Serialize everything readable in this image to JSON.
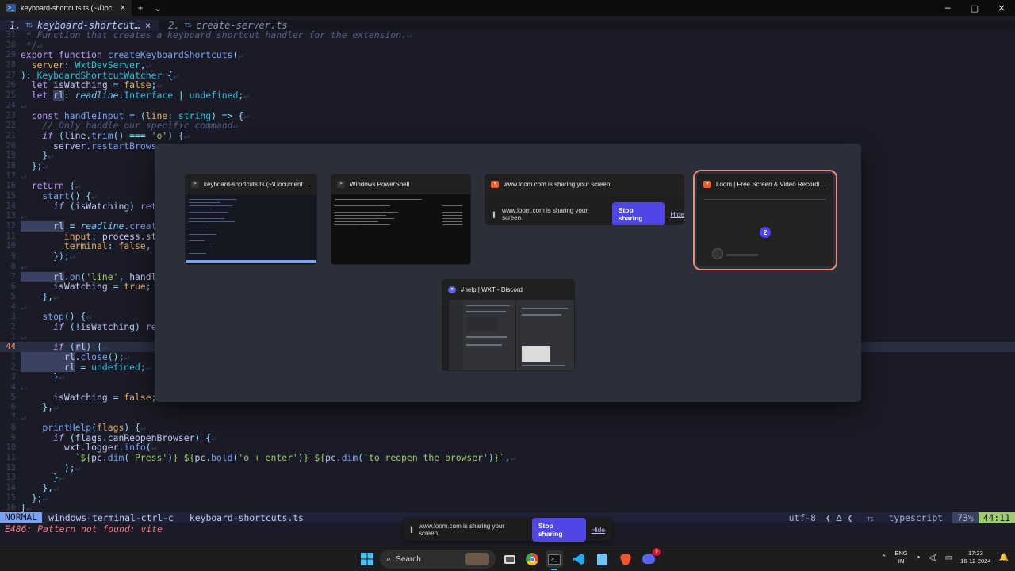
{
  "terminal": {
    "active_tab": "keyboard-shortcuts.ts (~\\Doc",
    "new_tab": "+",
    "dropdown": "⌄",
    "close": "×",
    "minimize": "─",
    "maximize": "▢",
    "close_window": "✕"
  },
  "vim": {
    "tabs": [
      {
        "index": "1.",
        "type": "TS",
        "name": "keyboard-shortcut…",
        "close": "×"
      },
      {
        "index": "2.",
        "type": "TS",
        "name": "create-server.ts",
        "close": ""
      }
    ],
    "status": {
      "mode": "NORMAL",
      "branch": " windows-terminal-ctrl-c",
      "file": "keyboard-shortcuts.ts",
      "encoding": "utf-8",
      "os": "❮ ∆ ❮",
      "filetype_icon": "TS",
      "filetype": "typescript",
      "percent": "73%",
      "position": "44:11"
    },
    "cmdline": "E486: Pattern not found: vite"
  },
  "switcher": {
    "windows": [
      {
        "title": "keyboard-shortcuts.ts (~\\Document…",
        "icon": "terminal-icon"
      },
      {
        "title": "Windows PowerShell",
        "icon": "terminal-icon"
      },
      {
        "title": "www.loom.com is sharing your screen.",
        "icon": "brave-icon",
        "bar_text": "www.loom.com is sharing your screen.",
        "stop": "Stop sharing",
        "hide": "Hide"
      },
      {
        "title": "Loom | Free Screen & Video Recordi…",
        "icon": "brave-icon",
        "badge": "2"
      },
      {
        "title": "#help | WXT - Discord",
        "icon": "discord-icon"
      }
    ]
  },
  "loom_bar": {
    "text": "www.loom.com is sharing your screen.",
    "stop": "Stop sharing",
    "hide": "Hide"
  },
  "taskbar": {
    "search": "Search",
    "lang_top": "ENG",
    "lang_bottom": "IN",
    "time": "17:23",
    "date": "16-12-2024",
    "discord_badge": "9"
  },
  "colors": {
    "accent": "#7aa2f7",
    "selection_outline": "#f28b74",
    "stop_button": "#4f46e5"
  }
}
